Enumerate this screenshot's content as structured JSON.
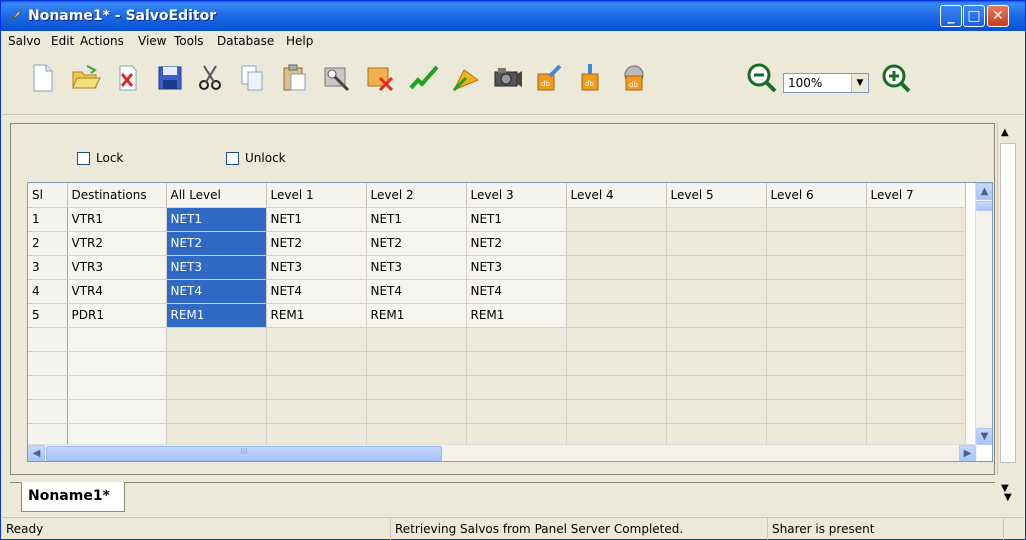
{
  "window": {
    "title": "Noname1* - SalvoEditor"
  },
  "menu": [
    "Salvo",
    "Edit",
    "Actions",
    "View",
    "Tools",
    "Database",
    "Help"
  ],
  "toolbar": {
    "icons": [
      "new-file-icon",
      "open-folder-icon",
      "close-x-icon",
      "save-disk-icon",
      "cut-scissors-icon",
      "copy-icon",
      "paste-icon",
      "panel-tool-icon",
      "delete-panel-icon",
      "check-green-icon",
      "arrow-play-icon",
      "camera-icon",
      "db-export-icon",
      "db-import-icon",
      "db-settings-icon",
      "zoom-out-icon",
      "zoom-in-icon"
    ],
    "zoom_value": "100%"
  },
  "options": {
    "lock_label": "Lock",
    "unlock_label": "Unlock"
  },
  "grid": {
    "columns": [
      "Sl",
      "Destinations",
      "All Level",
      "Level 1",
      "Level 2",
      "Level 3",
      "Level 4",
      "Level 5",
      "Level 6",
      "Level 7"
    ],
    "rows": [
      [
        "1",
        "VTR1",
        "NET1",
        "NET1",
        "NET1",
        "NET1",
        "",
        "",
        "",
        ""
      ],
      [
        "2",
        "VTR2",
        "NET2",
        "NET2",
        "NET2",
        "NET2",
        "",
        "",
        "",
        ""
      ],
      [
        "3",
        "VTR3",
        "NET3",
        "NET3",
        "NET3",
        "NET3",
        "",
        "",
        "",
        ""
      ],
      [
        "4",
        "VTR4",
        "NET4",
        "NET4",
        "NET4",
        "NET4",
        "",
        "",
        "",
        ""
      ],
      [
        "5",
        "PDR1",
        "REM1",
        "REM1",
        "REM1",
        "REM1",
        "",
        "",
        "",
        ""
      ]
    ],
    "empty_rows": 5,
    "hscroll_thumb": "III"
  },
  "tabs": {
    "active": "Noname1*"
  },
  "status": {
    "left": "Ready",
    "middle": "Retrieving Salvos from Panel Server Completed.",
    "right": "Sharer is present"
  },
  "colors": {
    "selection": "#316ac5",
    "titlebar": "#0a55d6",
    "background": "#ece9d8"
  }
}
